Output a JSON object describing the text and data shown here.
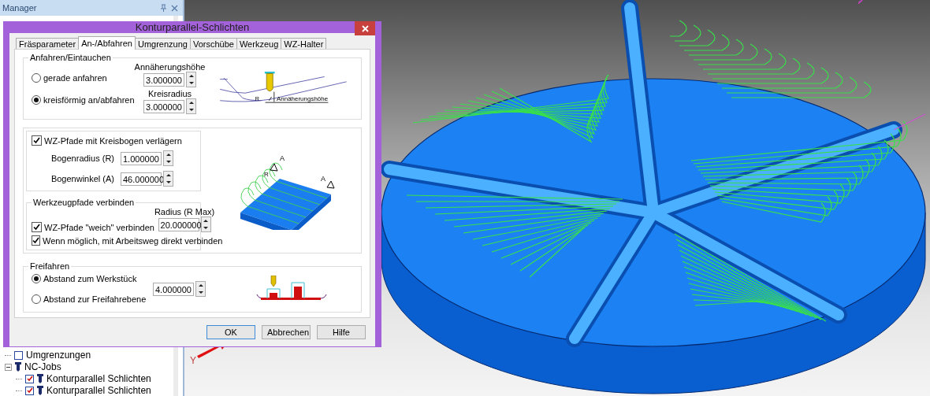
{
  "manager": {
    "title": "Manager"
  },
  "tree": [
    {
      "kind": "boundary",
      "label": "Umgrenzungen",
      "checked": false
    },
    {
      "kind": "folder",
      "label": "NC-Jobs",
      "expanded": true,
      "children": [
        {
          "label": "Konturparallel Schlichten",
          "checked": true
        },
        {
          "label": "Konturparallel Schlichten",
          "checked": true
        }
      ]
    }
  ],
  "viewport": {
    "axis_label": "Y"
  },
  "dialog": {
    "title": "Konturparallel-Schlichten",
    "tabs": [
      {
        "label": "Fräsparameter",
        "selected": false
      },
      {
        "label": "An-/Abfahren",
        "selected": true
      },
      {
        "label": "Umgrenzung",
        "selected": false
      },
      {
        "label": "Vorschübe",
        "selected": false
      },
      {
        "label": "Werkzeug",
        "selected": false
      },
      {
        "label": "WZ-Halter",
        "selected": false
      }
    ],
    "approach": {
      "title": "Anfahren/Eintauchen",
      "options": [
        {
          "label": "gerade anfahren",
          "selected": false,
          "field_label": "Annäherungshöhe",
          "value": "3.000000"
        },
        {
          "label": "kreisförmig an/abfahren",
          "selected": true,
          "field_label": "Kreisradius",
          "value": "3.000000"
        }
      ],
      "diagram_labels": [
        "R",
        "Annäherungshöhe"
      ]
    },
    "arc": {
      "checkbox": {
        "label": "WZ-Pfade mit Kreisbogen verlägern",
        "checked": true
      },
      "fields": [
        {
          "label": "Bogenradius (R)",
          "value": "1.000000"
        },
        {
          "label": "Bogenwinkel (A)",
          "value": "46.000000"
        }
      ],
      "diagram_labels": [
        "R",
        "A",
        "A"
      ]
    },
    "connect": {
      "title": "Werkzeugpfade verbinden",
      "field_label": "Radius (R Max)",
      "value": "20.000000",
      "checkboxes": [
        {
          "label": "WZ-Pfade \"weich\" verbinden",
          "checked": true
        },
        {
          "label": "Wenn möglich, mit Arbeitsweg direkt verbinden",
          "checked": true
        }
      ]
    },
    "retract": {
      "title": "Freifahren",
      "options": [
        {
          "label": "Abstand zum Werkstück",
          "selected": true
        },
        {
          "label": "Abstand zur Freifahrebene",
          "selected": false
        }
      ],
      "value": "4.000000"
    },
    "buttons": [
      {
        "label": "OK",
        "default": true
      },
      {
        "label": "Abbrechen",
        "default": false
      },
      {
        "label": "Hilfe",
        "default": false
      }
    ]
  }
}
